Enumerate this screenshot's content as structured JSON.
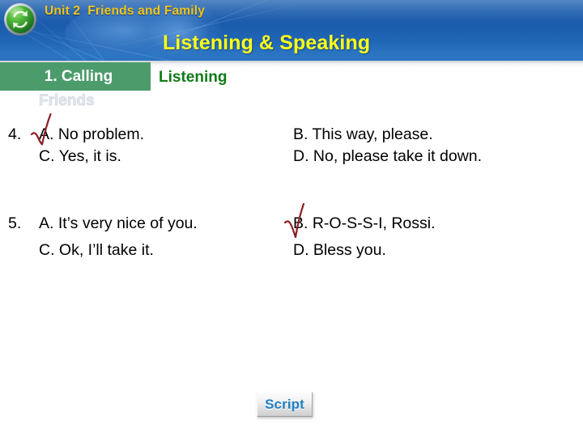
{
  "slide": {
    "header": {
      "logo_icon": "green-recycle-circle-icon",
      "unit_label": "Unit 2  Friends and Family",
      "title": "Listening & Speaking",
      "title_color": "#ffff1a",
      "unit_color": "#f2c518",
      "band_color": "#1f5fae"
    },
    "tab": {
      "label": "1. Calling",
      "ghost_label": "Friends",
      "color": "#4b9b6b"
    },
    "section": {
      "heading": "Listening",
      "heading_color": "#117a17"
    },
    "questions": [
      {
        "number": "4.",
        "options": {
          "a": "A. No problem.",
          "b": "B. This way, please.",
          "c": "C. Yes, it is.",
          "d": "D. No, please take it down."
        },
        "marked": "a",
        "mark_icon": "red-check-mark-icon",
        "mark_color": "#8c1f22"
      },
      {
        "number": "5.",
        "options": {
          "a": "A. It’s very nice of you.",
          "b": "B. R-O-S-S-I, Rossi.",
          "c": "C. Ok, I’ll take it.",
          "d": "D. Bless you."
        },
        "marked": "b",
        "mark_icon": "red-check-mark-icon",
        "mark_color": "#8c1f22"
      }
    ],
    "footer": {
      "script_button_label": "Script",
      "script_button_color": "#1f7fc4"
    }
  }
}
